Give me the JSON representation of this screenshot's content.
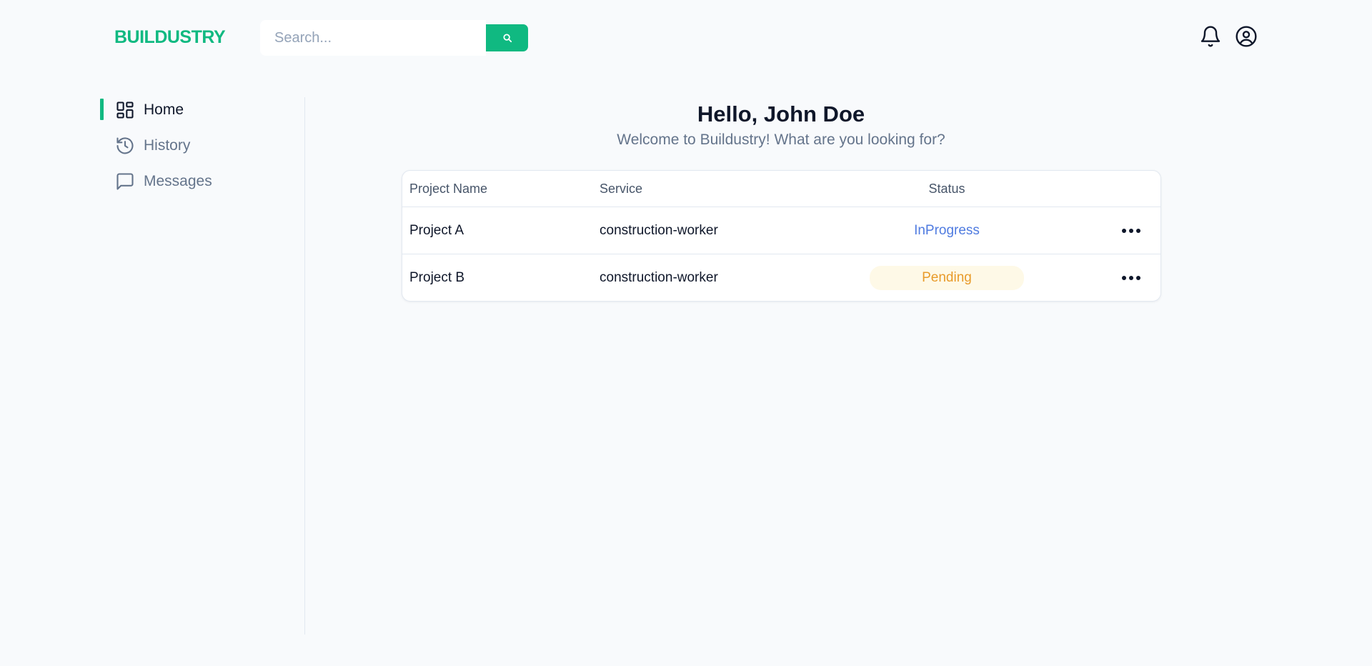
{
  "header": {
    "logo": "BUILDUSTRY",
    "search_placeholder": "Search...",
    "search_value": "",
    "icons": [
      "search-icon",
      "bell-icon",
      "user-circle-icon"
    ]
  },
  "sidebar": {
    "items": [
      {
        "label": "Home",
        "icon": "grid-icon",
        "active": true
      },
      {
        "label": "History",
        "icon": "history-icon",
        "active": false
      },
      {
        "label": "Messages",
        "icon": "message-icon",
        "active": false
      }
    ]
  },
  "main": {
    "greeting": "Hello, John Doe",
    "subtitle": "Welcome to Buildustry! What are you looking for?",
    "table": {
      "headers": [
        "Project Name",
        "Service",
        "Status"
      ],
      "rows": [
        {
          "name": "Project A",
          "service": "construction-worker",
          "status": "InProgress"
        },
        {
          "name": "Project B",
          "service": "construction-worker",
          "status": "Pending"
        }
      ]
    }
  },
  "colors": {
    "accent": "#10b981",
    "status_inprogress": "#4f7be0",
    "status_pending": "#e89b2a",
    "status_pending_bg": "#fef9e7"
  }
}
